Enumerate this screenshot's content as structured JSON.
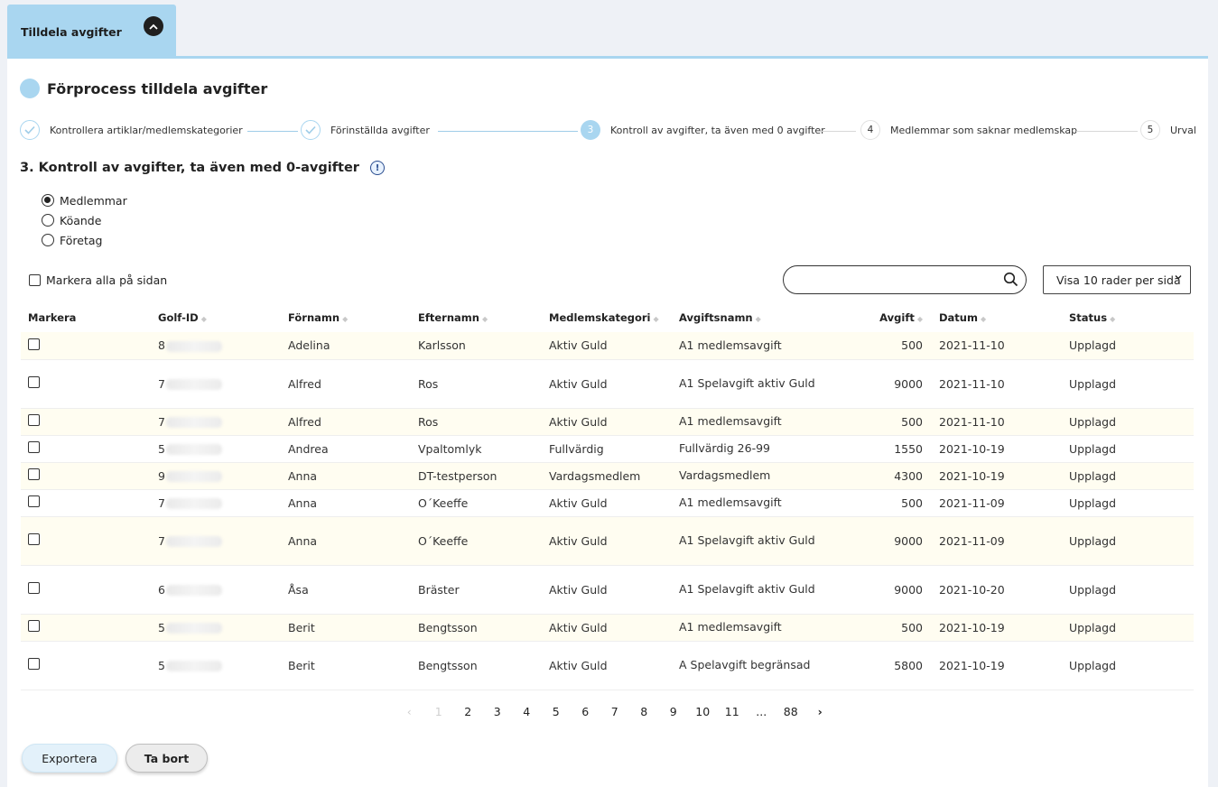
{
  "tab": {
    "label": "Tilldela avgifter"
  },
  "page_title": "Förprocess tilldela avgifter",
  "steps": [
    {
      "label": "Kontrollera artiklar/medlemskategorier",
      "state": "done"
    },
    {
      "label": "Förinställda avgifter",
      "state": "done"
    },
    {
      "number": "3",
      "label": "Kontroll av avgifter, ta även med 0 avgifter",
      "state": "active"
    },
    {
      "number": "4",
      "label": "Medlemmar som saknar medlemskap",
      "state": "todo"
    },
    {
      "number": "5",
      "label": "Urval",
      "state": "todo"
    }
  ],
  "section_title": "3. Kontroll av avgifter, ta även med 0-avgifter",
  "radio_options": [
    {
      "label": "Medlemmar",
      "checked": true
    },
    {
      "label": "Köande",
      "checked": false
    },
    {
      "label": "Företag",
      "checked": false
    }
  ],
  "mark_all_label": "Markera alla på sidan",
  "search": {
    "value": "",
    "placeholder": ""
  },
  "rows_per_page": "Visa 10 rader per sida",
  "columns": [
    "Markera",
    "Golf-ID",
    "Förnamn",
    "Efternamn",
    "Medlemskategori",
    "Avgiftsnamn",
    "Avgift",
    "Datum",
    "Status"
  ],
  "rows": [
    {
      "golf_id": "8",
      "first": "Adelina",
      "last": "Karlsson",
      "category": "Aktiv Guld",
      "fee_name": "A1 medlemsavgift",
      "fee": "500",
      "date": "2021-11-10",
      "status": "Upplagd"
    },
    {
      "golf_id": "7",
      "first": "Alfred",
      "last": "Ros",
      "category": "Aktiv Guld",
      "fee_name": "A1 Spelavgift aktiv Guld",
      "fee": "9000",
      "date": "2021-11-10",
      "status": "Upplagd"
    },
    {
      "golf_id": "7",
      "first": "Alfred",
      "last": "Ros",
      "category": "Aktiv Guld",
      "fee_name": "A1 medlemsavgift",
      "fee": "500",
      "date": "2021-11-10",
      "status": "Upplagd"
    },
    {
      "golf_id": "5",
      "first": "Andrea",
      "last": "Vpaltomlyk",
      "category": "Fullvärdig",
      "fee_name": "Fullvärdig 26-99",
      "fee": "1550",
      "date": "2021-10-19",
      "status": "Upplagd"
    },
    {
      "golf_id": "9",
      "first": "Anna",
      "last": "DT-testperson",
      "category": "Vardagsmedlem",
      "fee_name": "Vardagsmedlem",
      "fee": "4300",
      "date": "2021-10-19",
      "status": "Upplagd"
    },
    {
      "golf_id": "7",
      "first": "Anna",
      "last": "O´Keeffe",
      "category": "Aktiv Guld",
      "fee_name": "A1 medlemsavgift",
      "fee": "500",
      "date": "2021-11-09",
      "status": "Upplagd"
    },
    {
      "golf_id": "7",
      "first": "Anna",
      "last": "O´Keeffe",
      "category": "Aktiv Guld",
      "fee_name": "A1 Spelavgift aktiv Guld",
      "fee": "9000",
      "date": "2021-11-09",
      "status": "Upplagd"
    },
    {
      "golf_id": "6",
      "first": "Åsa",
      "last": "Bräster",
      "category": "Aktiv Guld",
      "fee_name": "A1 Spelavgift aktiv Guld",
      "fee": "9000",
      "date": "2021-10-20",
      "status": "Upplagd"
    },
    {
      "golf_id": "5",
      "first": "Berit",
      "last": "Bengtsson",
      "category": "Aktiv Guld",
      "fee_name": "A1 medlemsavgift",
      "fee": "500",
      "date": "2021-10-19",
      "status": "Upplagd"
    },
    {
      "golf_id": "5",
      "first": "Berit",
      "last": "Bengtsson",
      "category": "Aktiv Guld",
      "fee_name": "A Spelavgift begränsad",
      "fee": "5800",
      "date": "2021-10-19",
      "status": "Upplagd"
    }
  ],
  "pagination": {
    "prev": "‹",
    "pages": [
      "1",
      "2",
      "3",
      "4",
      "5",
      "6",
      "7",
      "8",
      "9",
      "10",
      "11",
      "...",
      "88"
    ],
    "current": "1",
    "next": "›"
  },
  "buttons": {
    "export": "Exportera",
    "delete": "Ta bort"
  }
}
